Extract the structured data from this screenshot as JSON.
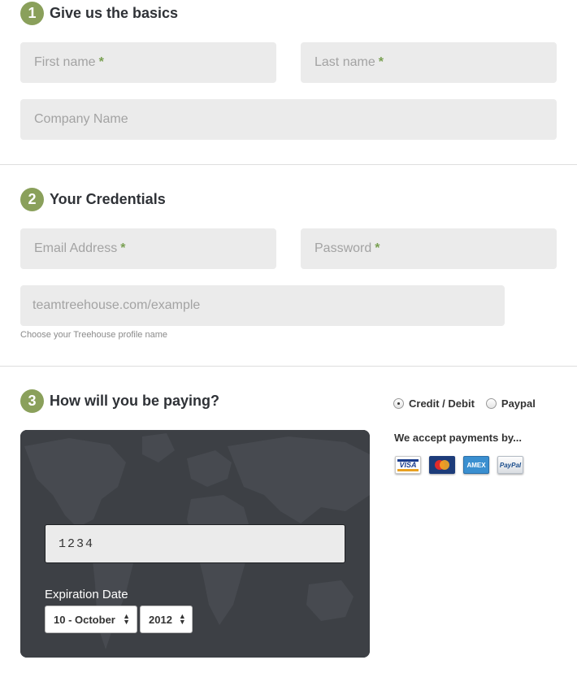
{
  "section1": {
    "number": "1",
    "title": "Give us the basics",
    "first_name_placeholder": "First name",
    "last_name_placeholder": "Last name",
    "company_placeholder": "Company Name",
    "required_mark": "*"
  },
  "section2": {
    "number": "2",
    "title": "Your Credentials",
    "email_placeholder": "Email Address",
    "password_placeholder": "Password",
    "profile_placeholder": "teamtreehouse.com/example",
    "profile_hint": "Choose your Treehouse profile name",
    "required_mark": "*"
  },
  "section3": {
    "number": "3",
    "title": "How will you be paying?",
    "payment_options": [
      {
        "label": "Credit / Debit",
        "selected": true
      },
      {
        "label": "Paypal",
        "selected": false
      }
    ],
    "accept_label": "We accept payments by...",
    "card_logos": [
      {
        "name": "visa-icon",
        "text": "VISA"
      },
      {
        "name": "mastercard-icon",
        "text": ""
      },
      {
        "name": "amex-icon",
        "text": "AMEX"
      },
      {
        "name": "paypal-icon",
        "text": "PayPal"
      }
    ],
    "card_number_value": "1234",
    "expiration_label": "Expiration Date",
    "month_select_value": "10 - October",
    "year_select_value": "2012"
  },
  "colors": {
    "accent_green": "#8aa05b",
    "field_bg": "#ebebeb",
    "panel_bg": "#3c3f44"
  }
}
